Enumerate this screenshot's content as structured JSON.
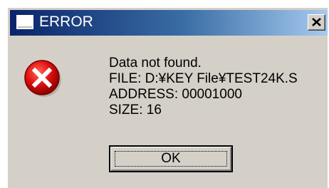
{
  "window": {
    "title": "ERROR",
    "close_glyph": "✕"
  },
  "message": {
    "lines": [
      "Data not found.",
      "FILE: D:¥KEY File¥TEST24K.S",
      "ADDRESS: 00001000",
      "SIZE: 16"
    ]
  },
  "buttons": {
    "ok_label": "OK"
  },
  "icons": {
    "app": "window-icon",
    "status": "error-icon",
    "close": "close-icon"
  },
  "colors": {
    "titlebar_start": "#0a246a",
    "titlebar_end": "#a6caf0",
    "dialog_bg": "#d4d0c8",
    "error_red": "#e01010"
  }
}
